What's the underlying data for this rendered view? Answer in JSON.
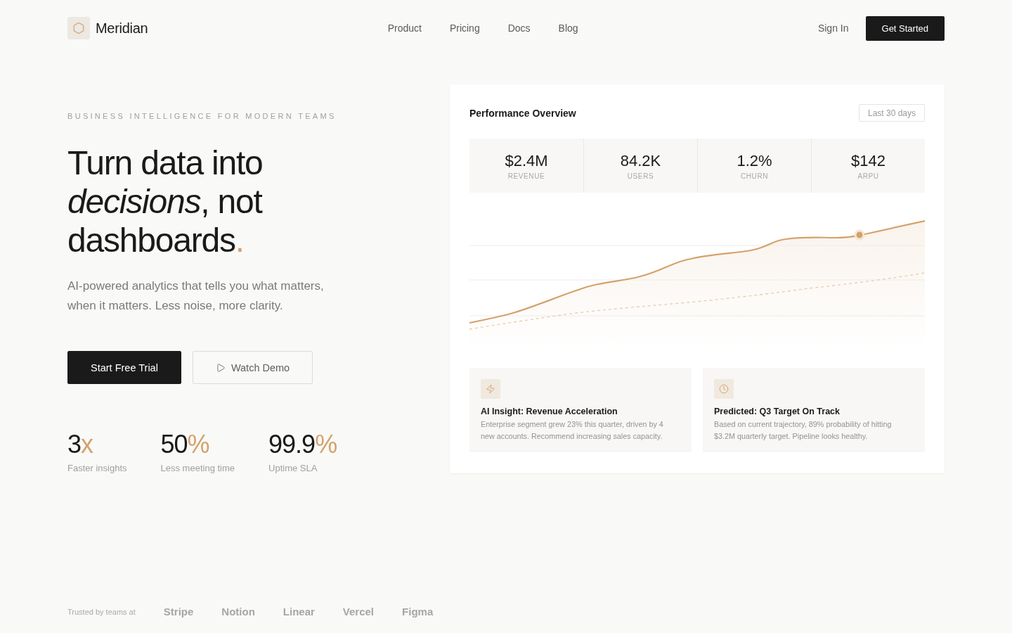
{
  "header": {
    "brand": "Meridian",
    "nav": [
      "Product",
      "Pricing",
      "Docs",
      "Blog"
    ],
    "sign_in": "Sign In",
    "cta": "Get Started"
  },
  "hero": {
    "eyebrow": "BUSINESS INTELLIGENCE FOR MODERN TEAMS",
    "headline": {
      "text": "Turn data into *decisions*, not dashboards",
      "accent": "."
    },
    "description": "AI-powered analytics that tells you what matters, when it matters. Less noise, more clarity.",
    "buttons": [
      {
        "kind": "primary",
        "label": "Start Free Trial"
      },
      {
        "kind": "secondary",
        "label": "Watch Demo"
      }
    ],
    "stats": [
      {
        "value": "3",
        "unit": "x",
        "label": "Faster insights"
      },
      {
        "value": "50",
        "unit": "%",
        "label": "Less meeting time"
      },
      {
        "value": "99.9",
        "unit": "%",
        "label": "Uptime SLA"
      }
    ]
  },
  "dashboard": {
    "title": "Performance Overview",
    "range": "Last 30 days",
    "metrics": [
      {
        "value": "$2.4M",
        "label": "REVENUE"
      },
      {
        "value": "84.2K",
        "label": "USERS"
      },
      {
        "value": "1.2%",
        "label": "CHURN"
      },
      {
        "value": "$142",
        "label": "ARPU"
      }
    ],
    "insights": [
      {
        "kind": "insight",
        "title": "AI Insight: Revenue Acceleration",
        "body": "Enterprise segment grew 23% this quarter, driven by 4 new accounts. Recommend increasing sales capacity."
      },
      {
        "kind": "prediction",
        "title": "Predicted: Q3 Target On Track",
        "body": "Based on current trajectory, 89% probability of hitting $3.2M quarterly target. Pipeline looks healthy."
      }
    ]
  },
  "trusted": {
    "label": "Trusted by teams at",
    "companies": [
      "Stripe",
      "Notion",
      "Linear",
      "Vercel",
      "Figma"
    ]
  }
}
